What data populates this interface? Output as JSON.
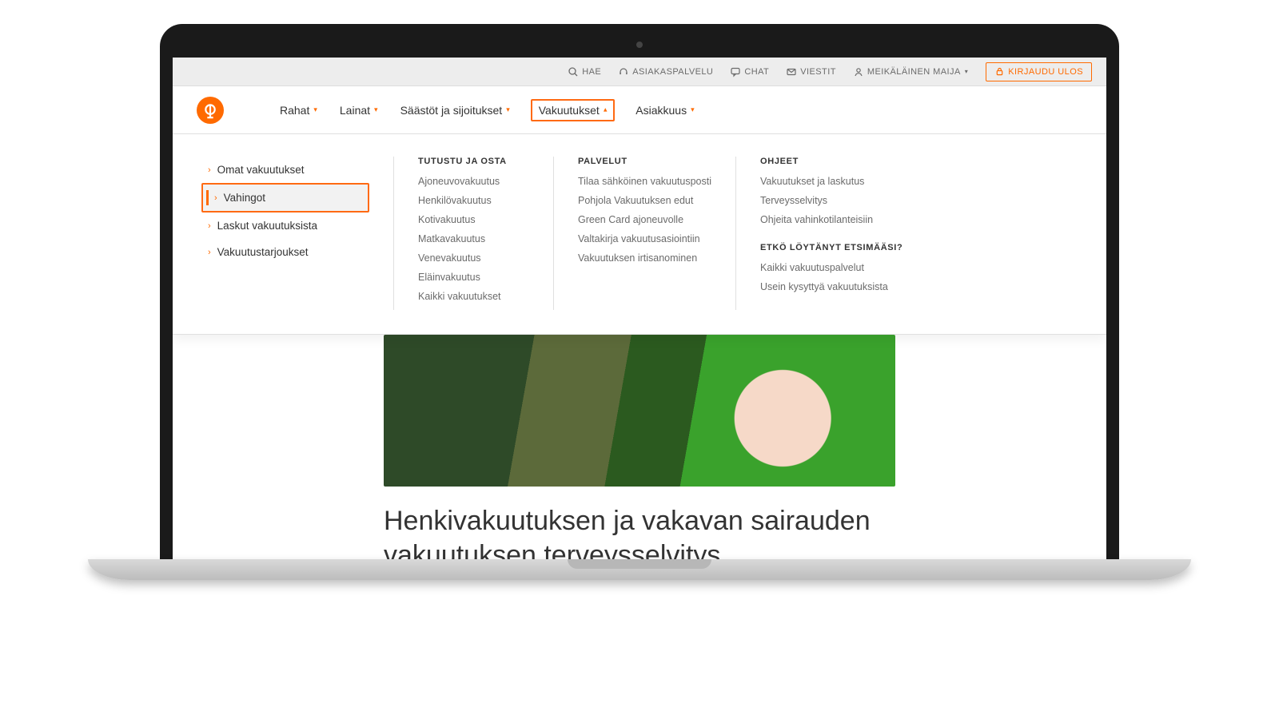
{
  "topbar": {
    "search": "HAE",
    "support": "ASIAKASPALVELU",
    "chat": "CHAT",
    "messages": "VIESTIT",
    "user": "MEIKÄLÄINEN MAIJA",
    "logout": "KIRJAUDU ULOS"
  },
  "nav": {
    "items": [
      "Rahat",
      "Lainat",
      "Säästöt ja sijoitukset",
      "Vakuutukset",
      "Asiakkuus"
    ],
    "active_index": 3
  },
  "mega": {
    "quick": [
      "Omat vakuutukset",
      "Vahingot",
      "Laskut vakuutuksista",
      "Vakuutustarjoukset"
    ],
    "quick_active_index": 1,
    "col1": {
      "heading": "TUTUSTU JA OSTA",
      "links": [
        "Ajoneuvovakuutus",
        "Henkilövakuutus",
        "Kotivakuutus",
        "Matkavakuutus",
        "Venevakuutus",
        "Eläinvakuutus",
        "Kaikki vakuutukset"
      ]
    },
    "col2": {
      "heading": "PALVELUT",
      "links": [
        "Tilaa sähköinen vakuutusposti",
        "Pohjola Vakuutuksen edut",
        "Green Card ajoneuvolle",
        "Valtakirja vakuutusasiointiin",
        "Vakuutuksen irtisanominen"
      ]
    },
    "col3a": {
      "heading": "OHJEET",
      "links": [
        "Vakuutukset ja laskutus",
        "Terveysselvitys",
        "Ohjeita vahinkotilanteisiin"
      ]
    },
    "col3b": {
      "heading": "ETKÖ LÖYTÄNYT ETSIMÄÄSI?",
      "links": [
        "Kaikki vakuutuspalvelut",
        "Usein kysyttyä vakuutuksista"
      ]
    }
  },
  "page": {
    "title": "Henkivakuutuksen ja vakavan sairauden vakuutuksen terveysselvitys"
  }
}
